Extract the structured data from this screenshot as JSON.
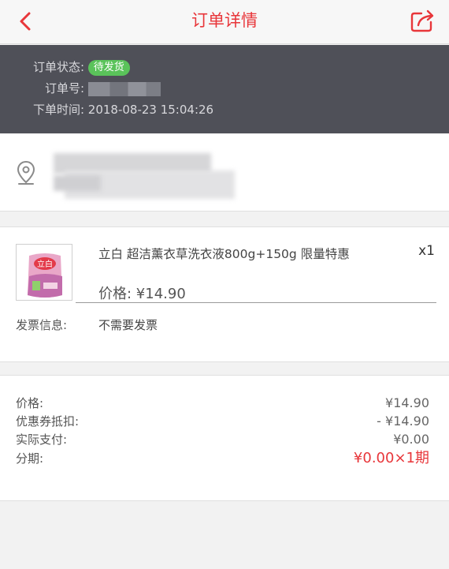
{
  "nav": {
    "title": "订单详情",
    "back_icon": "chevron-left-icon",
    "share_icon": "share-icon",
    "accent": "#e8363a"
  },
  "order": {
    "status_label": "订单状态:",
    "status_value": "待发货",
    "number_label": "订单号:",
    "time_label": "下单时间:",
    "time_value": "2018-08-23 15:04:26"
  },
  "address": {
    "icon": "location-pin-icon"
  },
  "goods": {
    "name": "立白 超洁薰衣草洗衣液800g+150g 限量特惠",
    "qty": "x1",
    "price": "价格: ¥14.90",
    "thumb_brand": "立白",
    "invoice_label": "发票信息:",
    "invoice_value": "不需要发票"
  },
  "summary": {
    "price_label": "价格:",
    "price_value": "¥14.90",
    "coupon_label": "优惠券抵扣:",
    "coupon_value": "- ¥14.90",
    "paid_label": "实际支付:",
    "paid_value": "¥0.00",
    "installment_label": "分期:",
    "installment_value": "¥0.00×1期"
  }
}
